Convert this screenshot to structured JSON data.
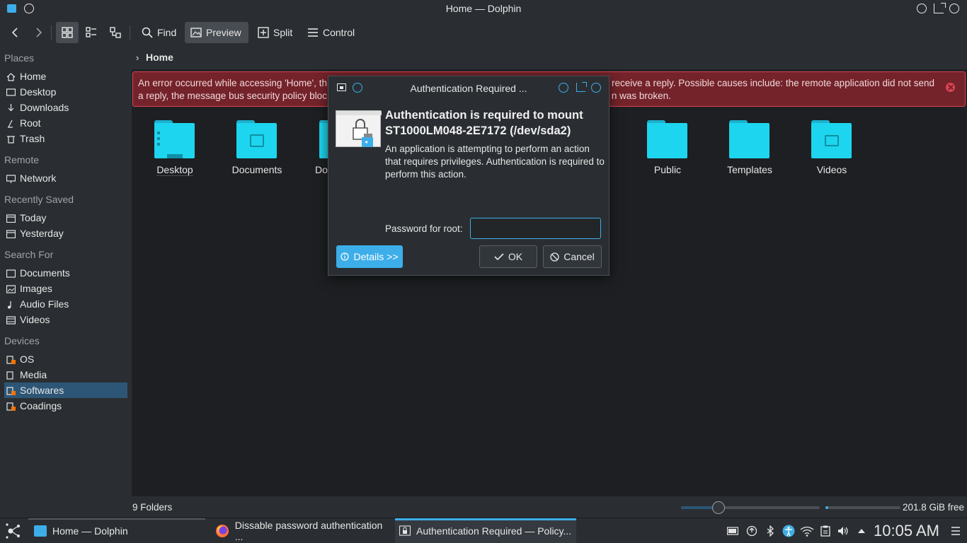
{
  "window": {
    "title": "Home — Dolphin"
  },
  "toolbar": {
    "find": "Find",
    "preview": "Preview",
    "split": "Split",
    "control": "Control"
  },
  "sidebar": {
    "places_header": "Places",
    "places": [
      "Home",
      "Desktop",
      "Downloads",
      "Root",
      "Trash"
    ],
    "remote_header": "Remote",
    "remote": [
      "Network"
    ],
    "recent_header": "Recently Saved",
    "recent": [
      "Today",
      "Yesterday"
    ],
    "search_header": "Search For",
    "search": [
      "Documents",
      "Images",
      "Audio Files",
      "Videos"
    ],
    "devices_header": "Devices",
    "devices": [
      "OS",
      "Media",
      "Softwares",
      "Coadings"
    ],
    "selected": "Softwares"
  },
  "breadcrumb": {
    "current": "Home"
  },
  "error": {
    "line1_left": "An error occurred while accessing 'Home', th",
    "line1_right": "receive a reply. Possible causes include: the remote application did not send",
    "line2_left": "a reply, the message bus security policy bloc",
    "line2_right": "n was broken."
  },
  "folders": [
    {
      "name": "Desktop"
    },
    {
      "name": "Documents"
    },
    {
      "name": "Do"
    },
    {
      "name": "Public"
    },
    {
      "name": "Templates"
    },
    {
      "name": "Videos"
    }
  ],
  "status": {
    "count": "9 Folders",
    "free": "201.8 GiB free",
    "zoom_level": 0.27,
    "used_fraction": 0.04
  },
  "dialog": {
    "title": "Authentication Required ...",
    "heading": "Authentication is required to mount ST1000LM048-2E7172 (/dev/sda2)",
    "description": "An application is attempting to perform an action that requires privileges. Authentication is required to perform this action.",
    "password_label": "Password for root:",
    "password_value": "",
    "details_label": "Details >>",
    "ok_label": "OK",
    "cancel_label": "Cancel"
  },
  "taskbar": {
    "tasks": [
      "Home — Dolphin",
      "Dissable password authentication ...",
      "Authentication Required — Policy..."
    ],
    "clock": "10:05 AM"
  },
  "colors": {
    "accent": "#3daee9",
    "error_bg": "#74232a",
    "folder": "#1dd5ee"
  }
}
